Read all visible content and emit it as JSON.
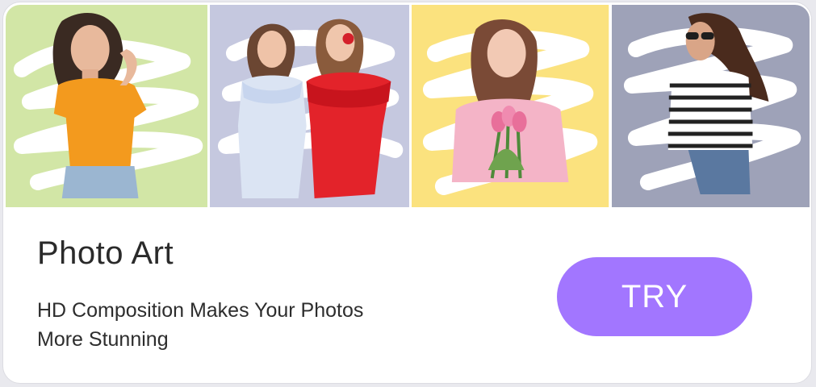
{
  "banner": {
    "title": "Photo Art",
    "subtitle_lines": [
      "HD Composition Makes Your Photos",
      "More Stunning"
    ],
    "try_label": "TRY"
  },
  "tiles": [
    {
      "bg": "#d2e6a6",
      "subject": "woman in orange top"
    },
    {
      "bg": "#c5c8df",
      "subject": "two girls, blue and red dresses"
    },
    {
      "bg": "#fbe27e",
      "subject": "woman in pink holding tulips"
    },
    {
      "bg": "#9ea2b8",
      "subject": "woman in striped top with sunglasses"
    }
  ],
  "colors": {
    "accent": "#a276ff",
    "title_text": "#2a2a2a"
  }
}
